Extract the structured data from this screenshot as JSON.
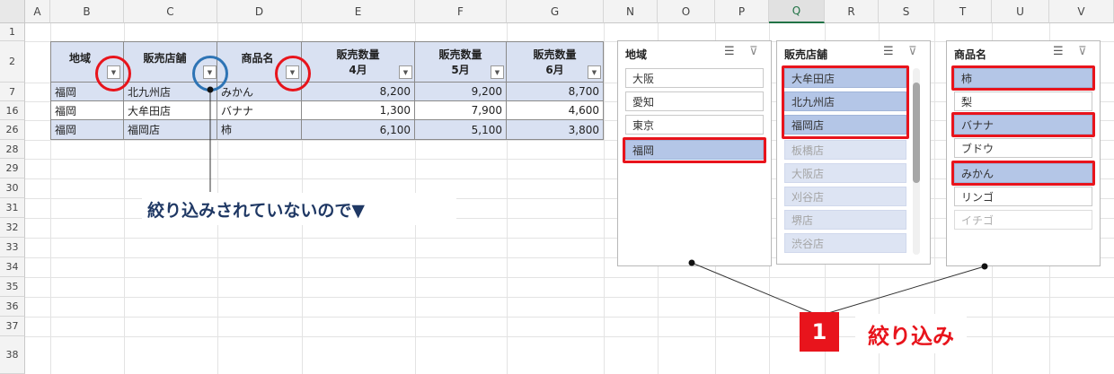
{
  "columns": [
    "A",
    "B",
    "C",
    "D",
    "E",
    "F",
    "G",
    "N",
    "O",
    "P",
    "Q",
    "R",
    "S",
    "T",
    "U",
    "V"
  ],
  "rows": [
    "1",
    "2",
    "7",
    "16",
    "26",
    "28",
    "29",
    "30",
    "31",
    "32",
    "33",
    "34",
    "35",
    "36",
    "37",
    "38"
  ],
  "table": {
    "headers": {
      "region": "地域",
      "store": "販売店舗",
      "product": "商品名",
      "qty_label": "販売数量",
      "apr": "4月",
      "may": "5月",
      "jun": "6月"
    },
    "data": [
      {
        "region": "福岡",
        "store": "北九州店",
        "product": "みかん",
        "apr": "8,200",
        "may": "9,200",
        "jun": "8,700"
      },
      {
        "region": "福岡",
        "store": "大牟田店",
        "product": "バナナ",
        "apr": "1,300",
        "may": "7,900",
        "jun": "4,600"
      },
      {
        "region": "福岡",
        "store": "福岡店",
        "product": "柿",
        "apr": "6,100",
        "may": "5,100",
        "jun": "3,800"
      }
    ]
  },
  "slicers": {
    "region": {
      "title": "地域",
      "items": [
        "大阪",
        "愛知",
        "東京",
        "福岡"
      ]
    },
    "store": {
      "title": "販売店舗",
      "items": [
        "大牟田店",
        "北九州店",
        "福岡店",
        "板橋店",
        "大阪店",
        "刈谷店",
        "堺店",
        "渋谷店"
      ]
    },
    "product": {
      "title": "商品名",
      "items": [
        "柿",
        "梨",
        "バナナ",
        "ブドウ",
        "みかん",
        "リンゴ",
        "イチゴ"
      ]
    }
  },
  "annotation": "絞り込みされていないので▼",
  "callout": {
    "number": "1",
    "label": "絞り込み"
  },
  "colors": {
    "accent_red": "#e8141c",
    "circle_blue": "#2e74b5",
    "header_fill": "#d9e1f2",
    "slicer_selected": "#b4c6e7",
    "annotation_text": "#1f3864"
  },
  "icons": {
    "multiselect": "multi-select-icon",
    "clear_filter": "clear-filter-icon",
    "filter_active": "filter-icon",
    "dropdown": "dropdown-arrow-icon"
  }
}
